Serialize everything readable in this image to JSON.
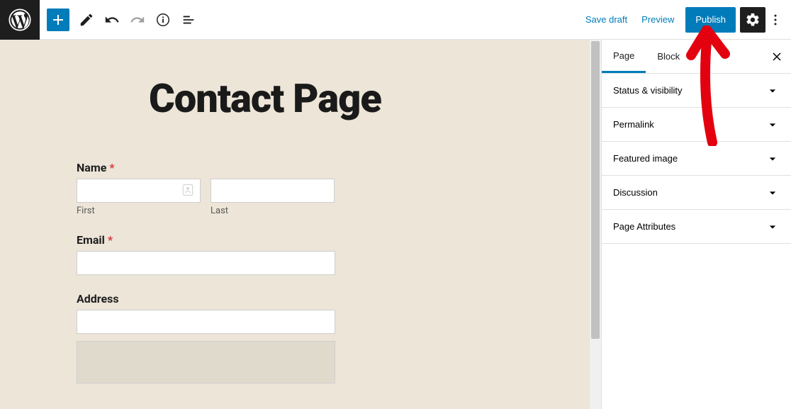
{
  "toolbar": {
    "save_draft": "Save draft",
    "preview": "Preview",
    "publish": "Publish"
  },
  "sidebar": {
    "tabs": {
      "page": "Page",
      "block": "Block"
    },
    "panels": [
      "Status & visibility",
      "Permalink",
      "Featured image",
      "Discussion",
      "Page Attributes"
    ]
  },
  "page": {
    "title": "Contact Page",
    "form": {
      "name_label": "Name",
      "first_label": "First",
      "last_label": "Last",
      "email_label": "Email",
      "address_label": "Address",
      "required_mark": "*"
    }
  }
}
